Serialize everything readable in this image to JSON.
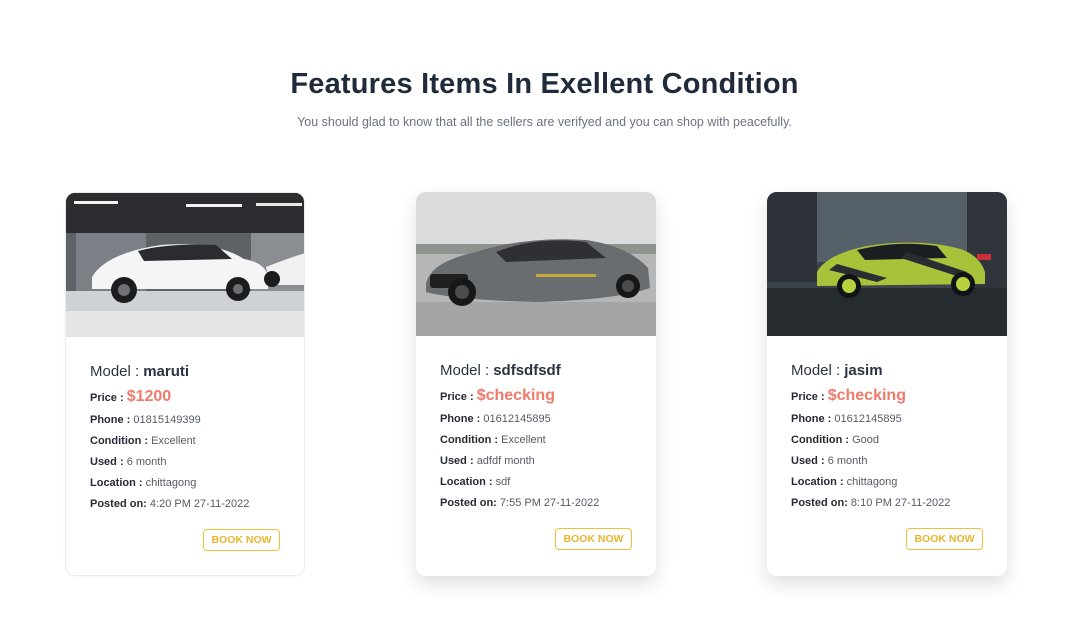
{
  "section": {
    "title": "Features Items In Exellent Condition",
    "subtitle": "You should glad to know that all the sellers are verifyed and you can shop with peacefully."
  },
  "labels": {
    "model": "Model :",
    "price": "Price :",
    "phone": "Phone :",
    "condition": "Condition :",
    "used": "Used :",
    "location": "Location :",
    "posted": "Posted on:",
    "book": "BOOK NOW"
  },
  "cards": [
    {
      "model": "maruti",
      "price": "$1200",
      "phone": "01815149399",
      "condition": "Excellent",
      "used": "6 month",
      "location": "chittagong",
      "posted": "4:20 PM 27-11-2022"
    },
    {
      "model": "sdfsdfsdf",
      "price": "$checking",
      "phone": "01612145895",
      "condition": "Excellent",
      "used": "adfdf month",
      "location": "sdf",
      "posted": "7:55 PM 27-11-2022"
    },
    {
      "model": "jasim",
      "price": "$checking",
      "phone": "01612145895",
      "condition": "Good",
      "used": "6 month",
      "location": "chittagong",
      "posted": "8:10 PM 27-11-2022"
    }
  ],
  "colors": {
    "price": "#f07a6c",
    "button": "#e8b52e",
    "heading": "#1f2a3a"
  }
}
